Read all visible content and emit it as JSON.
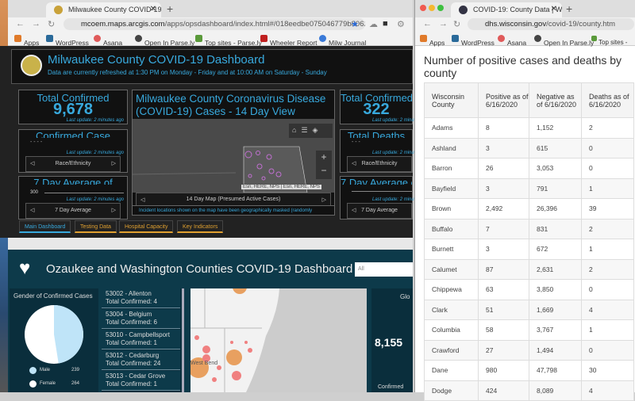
{
  "left_window": {
    "tab_title": "Milwaukee County COVID-19 D",
    "url_host": "mcoem.maps.arcgis.com",
    "url_path": "/apps/opsdashboard/index.html#/018eedbe075046779b8062b...",
    "bookmarks": [
      "Apps",
      "WordPress",
      "Asana",
      "Open In Parse.ly",
      "Top sites - Parse.ly",
      "Wheeler Report",
      "Milw Journal"
    ],
    "dashboard": {
      "title": "Milwaukee County COVID-19 Dashboard",
      "subtitle": "Data are currently refreshed at 1:30 PM on Monday - Friday and at 10:00 AM on Saturday - Sunday",
      "left_cards": [
        {
          "title": "Total Confirmed",
          "value": "9,678",
          "update": "Last update: 2 minutes ago"
        },
        {
          "title": "Confirmed Case",
          "value": "- - - -",
          "update": "Last update: 2 minutes ago",
          "pager": "Race/Ethnicity"
        },
        {
          "title": "7 Day Average of",
          "value": "300",
          "update": "Last update: 2 minutes ago",
          "pager": "7 Day Average"
        }
      ],
      "right_cards": [
        {
          "title": "Total Confirmed",
          "value": "322",
          "update": "Last update: 2 minutes ago"
        },
        {
          "title": "Total Deaths",
          "value": "- - -",
          "update": "Last update: 2 minutes ago",
          "pager": "Race/Ethnicity"
        },
        {
          "title": "7 Day Average of",
          "update": "Last update: 2 minutes ago",
          "pager": "7 Day Average"
        }
      ],
      "map_title": "Milwaukee County Coronavirus Disease (COVID-19) Cases - 14 Day View",
      "map_attribution": "Esri, HERE, NPS | Esri, HERE, NPS",
      "map_pager": "14 Day Map (Presumed Active Cases)",
      "map_note": "Incident locations shown on the map have been geographically masked (randomly",
      "tabs": [
        "Main Dashboard",
        "Testing Data",
        "Hospital Capacity",
        "Key Indicators"
      ],
      "active_tab": "Main Dashboard"
    },
    "ozaukee": {
      "title": "Ozaukee and Washington Counties COVID-19 Dashboard",
      "filter_value": "All",
      "gender_title": "Gender of Confirmed Cases",
      "gender": [
        {
          "label": "Male",
          "value": "239",
          "color": "#bfe4f8"
        },
        {
          "label": "Female",
          "value": "264",
          "color": "#ffffff"
        }
      ],
      "zips": [
        {
          "name": "53002 - Allenton",
          "total": "Total Confirmed: 4"
        },
        {
          "name": "53004 - Belgium",
          "total": "Total Confirmed: 6"
        },
        {
          "name": "53010 - Campbellsport",
          "total": "Total Confirmed: 1"
        },
        {
          "name": "53012 - Cedarburg",
          "total": "Total Confirmed: 24"
        },
        {
          "name": "53013 - Cedar Grove",
          "total": "Total Confirmed: 1"
        }
      ],
      "map_label": "West Bend",
      "global_title": "Glo",
      "global_value": "8,155",
      "global_label": "Confirmed"
    }
  },
  "right_window": {
    "tab_title": "COVID-19: County Data | Wisc",
    "url_host": "dhs.wisconsin.gov",
    "url_path": "/covid-19/county.htm",
    "bookmarks": [
      "Apps",
      "WordPress",
      "Asana",
      "Open In Parse.ly",
      "Top sites -"
    ],
    "heading": "Number of positive cases and deaths by county",
    "columns": [
      "Wisconsin County",
      "Positive as of 6/16/2020",
      "Negative as of 6/16/2020",
      "Deaths as of 6/16/2020"
    ],
    "rows": [
      [
        "Adams",
        "8",
        "1,152",
        "2"
      ],
      [
        "Ashland",
        "3",
        "615",
        "0"
      ],
      [
        "Barron",
        "26",
        "3,053",
        "0"
      ],
      [
        "Bayfield",
        "3",
        "791",
        "1"
      ],
      [
        "Brown",
        "2,492",
        "26,396",
        "39"
      ],
      [
        "Buffalo",
        "7",
        "831",
        "2"
      ],
      [
        "Burnett",
        "3",
        "672",
        "1"
      ],
      [
        "Calumet",
        "87",
        "2,631",
        "2"
      ],
      [
        "Chippewa",
        "63",
        "3,850",
        "0"
      ],
      [
        "Clark",
        "51",
        "1,669",
        "4"
      ],
      [
        "Columbia",
        "58",
        "3,767",
        "1"
      ],
      [
        "Crawford",
        "27",
        "1,494",
        "0"
      ],
      [
        "Dane",
        "980",
        "47,798",
        "30"
      ],
      [
        "Dodge",
        "424",
        "8,089",
        "4"
      ]
    ]
  },
  "colors": {
    "arcgis_blue": "#38a9dd",
    "tab_orange": "#e0a030",
    "oz_teal": "#0d3a4a"
  }
}
